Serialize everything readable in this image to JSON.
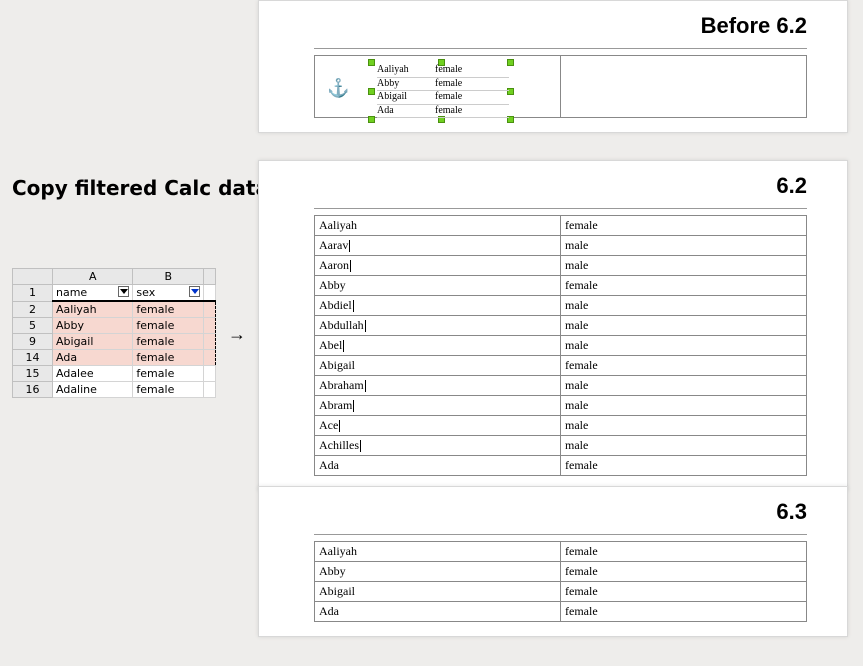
{
  "title": "Copy filtered Calc data into Writer tables",
  "arrow": "→",
  "calc": {
    "cols": [
      "",
      "A",
      "B",
      ""
    ],
    "headers": {
      "name": "name",
      "sex": "sex"
    },
    "rows": [
      {
        "n": "1",
        "name": "name",
        "sex": "sex",
        "hdr": true
      },
      {
        "n": "2",
        "name": "Aaliyah",
        "sex": "female",
        "sel": true
      },
      {
        "n": "5",
        "name": "Abby",
        "sex": "female",
        "sel": true
      },
      {
        "n": "9",
        "name": "Abigail",
        "sex": "female",
        "sel": true
      },
      {
        "n": "14",
        "name": "Ada",
        "sex": "female",
        "sel": true
      },
      {
        "n": "15",
        "name": "Adalee",
        "sex": "female"
      },
      {
        "n": "16",
        "name": "Adaline",
        "sex": "female"
      }
    ]
  },
  "panels": {
    "before": {
      "title": "Before 6.2",
      "ole_rows": [
        {
          "name": "Aaliyah",
          "sex": "female"
        },
        {
          "name": "Abby",
          "sex": "female"
        },
        {
          "name": "Abigail",
          "sex": "female"
        },
        {
          "name": "Ada",
          "sex": "female"
        }
      ]
    },
    "v62": {
      "title": "6.2",
      "rows": [
        {
          "name": "Aaliyah",
          "sex": "female"
        },
        {
          "name": "Aarav",
          "sex": "male",
          "cur": true
        },
        {
          "name": "Aaron",
          "sex": "male",
          "cur": true
        },
        {
          "name": "Abby",
          "sex": "female"
        },
        {
          "name": "Abdiel",
          "sex": "male",
          "cur": true
        },
        {
          "name": "Abdullah",
          "sex": "male",
          "cur": true
        },
        {
          "name": "Abel",
          "sex": "male",
          "cur": true
        },
        {
          "name": "Abigail",
          "sex": "female"
        },
        {
          "name": "Abraham",
          "sex": "male",
          "cur": true
        },
        {
          "name": "Abram",
          "sex": "male",
          "cur": true
        },
        {
          "name": "Ace",
          "sex": "male",
          "cur": true
        },
        {
          "name": "Achilles",
          "sex": "male",
          "cur": true
        },
        {
          "name": "Ada",
          "sex": "female"
        }
      ]
    },
    "v63": {
      "title": "6.3",
      "rows": [
        {
          "name": "Aaliyah",
          "sex": "female"
        },
        {
          "name": "Abby",
          "sex": "female"
        },
        {
          "name": "Abigail",
          "sex": "female"
        },
        {
          "name": "Ada",
          "sex": "female"
        }
      ]
    }
  }
}
